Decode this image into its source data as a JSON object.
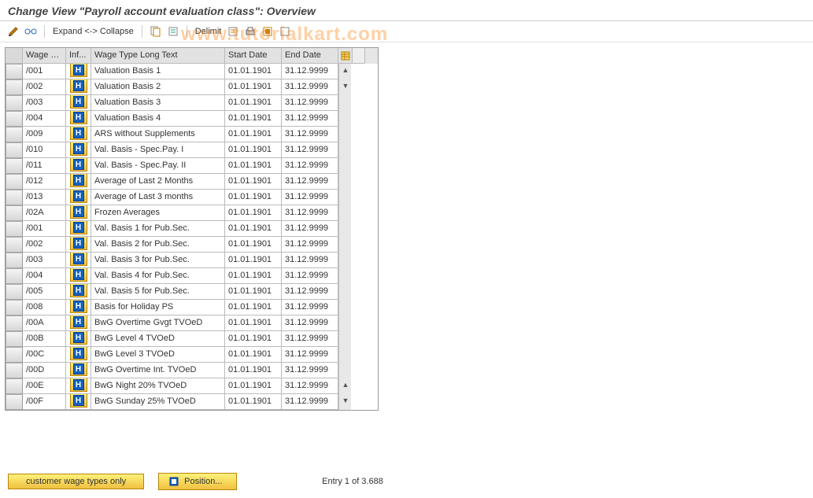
{
  "title": "Change View \"Payroll account evaluation class\": Overview",
  "watermark": "www.tutorialkart.com",
  "toolbar": {
    "expand": "Expand <-> Collapse",
    "delimit": "Delimit"
  },
  "columns": {
    "sel": "",
    "wt": "Wage Ty...",
    "inf": "Inf...",
    "txt": "Wage Type Long Text",
    "sd": "Start Date",
    "ed": "End Date"
  },
  "rows": [
    {
      "wt": "/001",
      "txt": "Valuation Basis 1",
      "sd": "01.01.1901",
      "ed": "31.12.9999"
    },
    {
      "wt": "/002",
      "txt": "Valuation Basis 2",
      "sd": "01.01.1901",
      "ed": "31.12.9999"
    },
    {
      "wt": "/003",
      "txt": "Valuation Basis 3",
      "sd": "01.01.1901",
      "ed": "31.12.9999"
    },
    {
      "wt": "/004",
      "txt": "Valuation Basis 4",
      "sd": "01.01.1901",
      "ed": "31.12.9999"
    },
    {
      "wt": "/009",
      "txt": "ARS without Supplements",
      "sd": "01.01.1901",
      "ed": "31.12.9999"
    },
    {
      "wt": "/010",
      "txt": "Val. Basis - Spec.Pay. I",
      "sd": "01.01.1901",
      "ed": "31.12.9999"
    },
    {
      "wt": "/011",
      "txt": "Val. Basis - Spec.Pay. II",
      "sd": "01.01.1901",
      "ed": "31.12.9999"
    },
    {
      "wt": "/012",
      "txt": "Average of Last 2 Months",
      "sd": "01.01.1901",
      "ed": "31.12.9999"
    },
    {
      "wt": "/013",
      "txt": "Average of Last 3 months",
      "sd": "01.01.1901",
      "ed": "31.12.9999"
    },
    {
      "wt": "/02A",
      "txt": "Frozen Averages",
      "sd": "01.01.1901",
      "ed": "31.12.9999"
    },
    {
      "wt": "/001",
      "txt": "Val. Basis 1 for Pub.Sec.",
      "sd": "01.01.1901",
      "ed": "31.12.9999"
    },
    {
      "wt": "/002",
      "txt": "Val. Basis 2 for Pub.Sec.",
      "sd": "01.01.1901",
      "ed": "31.12.9999"
    },
    {
      "wt": "/003",
      "txt": "Val. Basis 3 for Pub.Sec.",
      "sd": "01.01.1901",
      "ed": "31.12.9999"
    },
    {
      "wt": "/004",
      "txt": "Val. Basis 4 for Pub.Sec.",
      "sd": "01.01.1901",
      "ed": "31.12.9999"
    },
    {
      "wt": "/005",
      "txt": "Val. Basis 5 for Pub.Sec.",
      "sd": "01.01.1901",
      "ed": "31.12.9999"
    },
    {
      "wt": "/008",
      "txt": "Basis for Holiday PS",
      "sd": "01.01.1901",
      "ed": "31.12.9999"
    },
    {
      "wt": "/00A",
      "txt": "BwG Overtime Gvgt TVOeD",
      "sd": "01.01.1901",
      "ed": "31.12.9999"
    },
    {
      "wt": "/00B",
      "txt": "BwG Level 4 TVOeD",
      "sd": "01.01.1901",
      "ed": "31.12.9999"
    },
    {
      "wt": "/00C",
      "txt": "BwG Level 3 TVOeD",
      "sd": "01.01.1901",
      "ed": "31.12.9999"
    },
    {
      "wt": "/00D",
      "txt": "BwG Overtime Int. TVOeD",
      "sd": "01.01.1901",
      "ed": "31.12.9999"
    },
    {
      "wt": "/00E",
      "txt": "BwG Night 20% TVOeD",
      "sd": "01.01.1901",
      "ed": "31.12.9999"
    },
    {
      "wt": "/00F",
      "txt": "BwG Sunday 25% TVOeD",
      "sd": "01.01.1901",
      "ed": "31.12.9999"
    }
  ],
  "footer": {
    "btn_customer": "customer wage types only",
    "btn_position": "Position...",
    "entry": "Entry 1 of 3.688"
  }
}
